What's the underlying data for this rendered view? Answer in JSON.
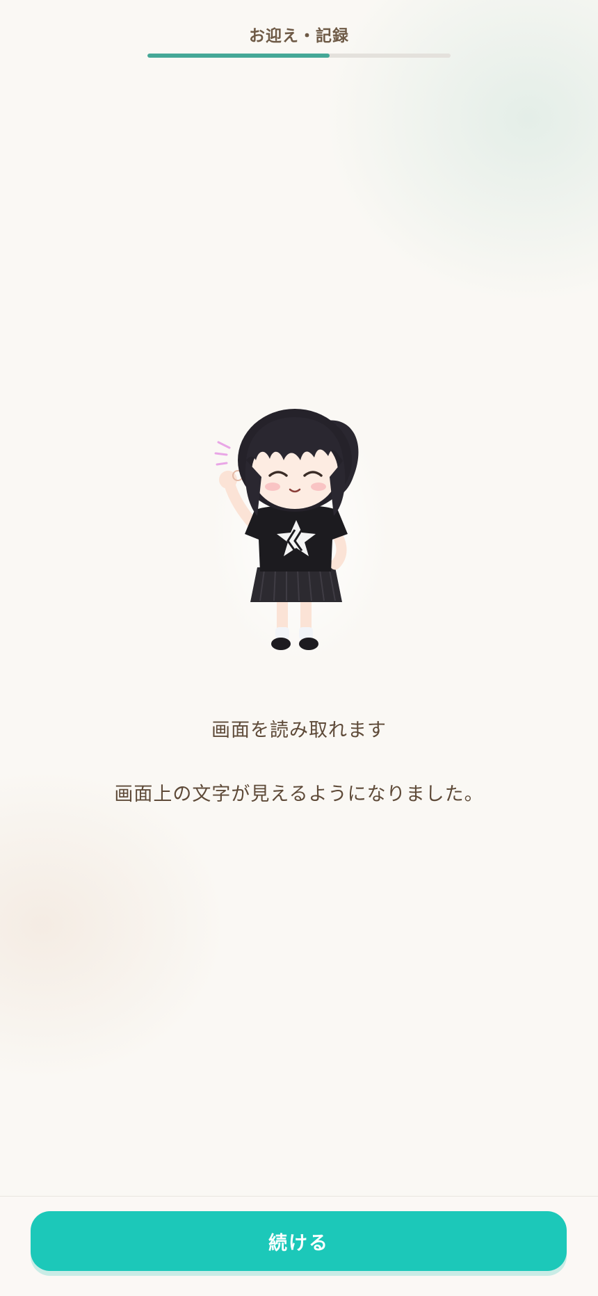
{
  "header": {
    "step_title": "お迎え・記録",
    "progress": 0.6
  },
  "main": {
    "mascot_icon": "chibi-girl-ok-gesture",
    "heading": "画面を読み取れます",
    "message": "画面上の文字が見えるようになりました。"
  },
  "footer": {
    "continue_label": "続ける"
  },
  "colors": {
    "accent": "#1cc8b9",
    "progress": "#45a897",
    "text": "#5e4a38"
  }
}
